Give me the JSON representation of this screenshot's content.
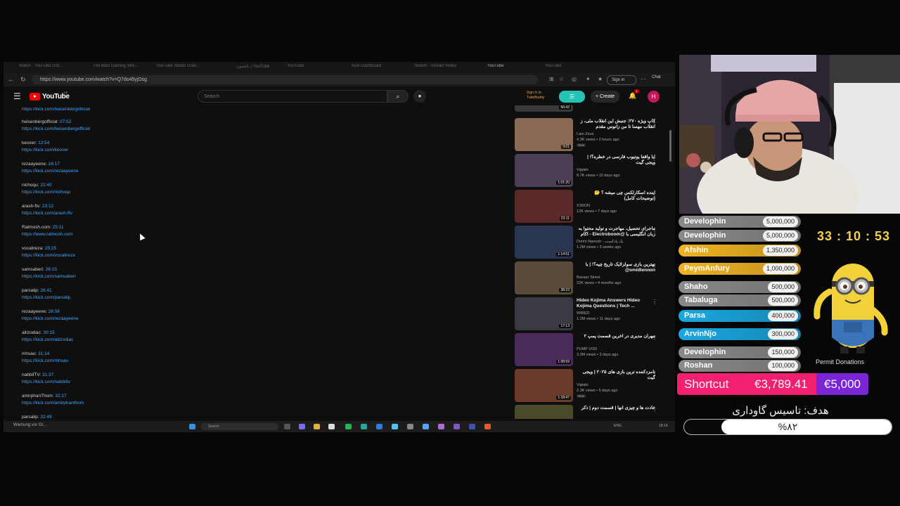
{
  "browser": {
    "tabs": [
      "Watch · YouTube Doc...",
      "The Best Gaming Stre...",
      "YouTube Studio Grav...",
      "داشبورد | YouTube",
      "- YouTube",
      "Kick Dashboard",
      "Notion - Stream Notes",
      "YouTube",
      "YouTube"
    ],
    "url": "https://www.youtube.com/watch?v=Q7do45yjDsg",
    "signin": "Sign in",
    "chat": "Chat"
  },
  "youtube": {
    "brand": "YouTube",
    "region": "DE",
    "search_placeholder": "Search",
    "tubebuddy": "Sign in to TubeBuddy",
    "create_label": "+ Create",
    "bell_count": "1",
    "avatar_letter": "H"
  },
  "description": {
    "top_link": "https://kick.com/heisenbergofficial",
    "entries": [
      {
        "name": "heisenbergofficial:",
        "time": "07:52",
        "link": "https://kick.com/heisenbergofficial"
      },
      {
        "name": "keoxer:",
        "time": "12:54",
        "link": "https://kick.com/keoxer"
      },
      {
        "name": "rezaayeene:",
        "time": "16:17",
        "link": "https://kick.com/rezaayeene"
      },
      {
        "name": "nichoqu:",
        "time": "22:40",
        "link": "https://kick.com/nichoqu"
      },
      {
        "name": "arash-ftv:",
        "time": "23:12",
        "link": "https://kick.com/arash-ftv"
      },
      {
        "name": "Ratmosh.com:",
        "time": "25:11",
        "link": "https://www.ratmosh.com"
      },
      {
        "name": "vocalireza:",
        "time": "25:25",
        "link": "https://kick.com/vocalireza"
      },
      {
        "name": "samsaberi:",
        "time": "26:15",
        "link": "https://kick.com/samsaberi"
      },
      {
        "name": "parsalip:",
        "time": "26:41",
        "link": "https://kick.com/parsalip"
      },
      {
        "name": "rezaayeene:",
        "time": "26:58",
        "link": "https://kick.com/rezaayeene"
      },
      {
        "name": "aliizodiac:",
        "time": "30:15",
        "link": "https://kick.com/aliizodiac"
      },
      {
        "name": "mhsao:",
        "time": "31:14",
        "link": "https://kick.com/mhsao"
      },
      {
        "name": "nabbilTV:",
        "time": "31:37",
        "link": "https://kick.com/nabbiltv"
      },
      {
        "name": "amirphanThom:",
        "time": "32:17",
        "link": "https://kick.com/amirphanthom"
      },
      {
        "name": "parsalip:",
        "time": "32:49",
        "link": ""
      }
    ]
  },
  "sidebar": {
    "top_duration": "56:42",
    "videos": [
      {
        "title": "کاپ ویژه ۲۷۰: جنبش این انقلاب ملی، ز انقلاب مهسا تا من زانوس مقدم",
        "channel": "I am Zeus",
        "meta": "4.3K views • 2 hours ago",
        "new": "New",
        "duration": "9:01",
        "rtl": true
      },
      {
        "title": "آیا واقعاً یوتیوب فارسی در خطره؟! | ویجی گیت",
        "channel": "Vigiato",
        "meta": "8.7K views • 10 days ago",
        "new": "",
        "duration": "1:01:20",
        "rtl": true
      },
      {
        "title": "آینده اسکارلکس چی میشه ؟ 🤔 (توضیحات کامل)",
        "channel": "X1RON",
        "meta": "12K views • 7 days ago",
        "new": "",
        "duration": "23:11",
        "rtl": true
      },
      {
        "title": "ماجرای تحصیل، مهاجرت و تولید محتوا به زبان انگلیسی با @Electroboom - اکام",
        "channel": "Dorim Nanosh · یک پادکست",
        "meta": "1.2M views • 3 weeks ago",
        "new": "",
        "duration": "1:14:51",
        "rtl": true
      },
      {
        "title": "بهترین بازی سولزلایک تاریخ چیه؟! | با omidlennon@",
        "channel": "Bazaar Street",
        "meta": "22K views • 4 months ago",
        "new": "",
        "duration": "38:23",
        "rtl": true
      },
      {
        "title": "Hideo Kojima Answers Hideo Kojima Questions | Tech ...",
        "channel": "WIRED",
        "meta": "1.2M views • 11 days ago",
        "new": "",
        "duration": "17:13",
        "rtl": false
      },
      {
        "title": "مهران مدیری در آخرین قسمت پمپ ۲",
        "channel": "PUMP VOD",
        "meta": "3.3M views • 3 days ago",
        "new": "",
        "duration": "1:08:59",
        "rtl": true
      },
      {
        "title": "نامزدکننده ترین بازی های ۲۰۲۵ | ویجی گیت",
        "channel": "Vigiato",
        "meta": "2.3K views • 5 days ago",
        "new": "New",
        "duration": "1:18:47",
        "rtl": true
      },
      {
        "title": "عادت ها و چیزی آنها | قسمت دوم | ذکر",
        "channel": "",
        "meta": "",
        "new": "",
        "duration": "",
        "rtl": true
      }
    ]
  },
  "taskbar": {
    "notice": "Warnung vor Gl...",
    "search": "Search",
    "lang": "ENG",
    "time": "18:14"
  },
  "overlay": {
    "timer": "33 : 10 : 53",
    "subtext": "Permit Donations",
    "donations": [
      {
        "name": "Develophin",
        "amount": "5,000,000",
        "color": "#8a8a8a"
      },
      {
        "name": "Develophin",
        "amount": "5,000,000",
        "color": "#8a8a8a"
      },
      {
        "name": "Afshin",
        "amount": "1,350,000",
        "color": "#f0b323"
      },
      {
        "name": "PeymAnfury",
        "amount": "1,000,000",
        "color": "#f0b323"
      },
      {
        "name": "Shaho",
        "amount": "500,000",
        "color": "#8a8a8a"
      },
      {
        "name": "Tabaluga",
        "amount": "500,000",
        "color": "#8a8a8a"
      },
      {
        "name": "Parsa",
        "amount": "400,000",
        "color": "#1aa7e0"
      },
      {
        "name": "ArvinNjo",
        "amount": "300,000",
        "color": "#1aa7e0"
      },
      {
        "name": "Develophin",
        "amount": "150,000",
        "color": "#8a8a8a"
      },
      {
        "name": "Roshan",
        "amount": "100,000",
        "color": "#8a8a8a"
      }
    ],
    "goal": {
      "label": "Shortcut",
      "current": "€3,789.41",
      "target": "€5,000",
      "title": "هدف: تاسیس گاوداری",
      "percent_text": "%۸۲",
      "progress": 0.82
    }
  },
  "colors": {
    "link": "#3ea6ff",
    "goal_pink": "#f2206f",
    "goal_purple": "#7b25d8",
    "timer": "#f6d14a",
    "tubebuddy": "#25c3b5"
  }
}
